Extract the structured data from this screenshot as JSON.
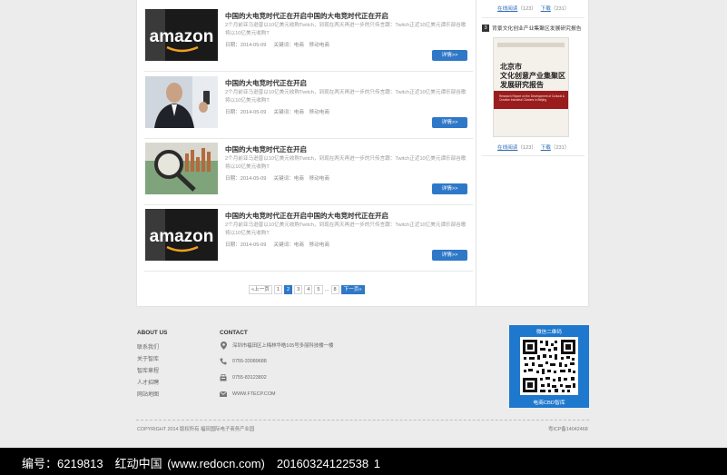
{
  "articles": [
    {
      "title": "中国的大电竞时代正在开启中国的大电竞时代正在开启",
      "desc": "2个月前亚马逊曾以10亿美元收购Twitch，到现在两天再进一步的只传言跟：Twitch正近10亿美元谭乐部谷歌将以10亿美元收购T",
      "date": "日期：2014-05-09",
      "keywords": "关键词：电商　移动电商",
      "more": "详情>>",
      "image": "amazon-logo-photo"
    },
    {
      "title": "中国的大电竞时代正在开启",
      "desc": "2个月前亚马逊曾以10亿美元收购Twitch，到现在两天再进一步的只传言跟：Twitch正近10亿美元谭乐部谷歌将以10亿美元收购T",
      "date": "日期：2014-05-09",
      "keywords": "关键词：电商　移动电商",
      "more": "详情>>",
      "image": "businessman-photo"
    },
    {
      "title": "中国的大电竞时代正在开启",
      "desc": "2个月前亚马逊曾以10亿美元收购Twitch，到现在两天再进一步的只传言跟：Twitch正近10亿美元谭乐部谷歌将以10亿美元收购T",
      "date": "日期：2014-05-09",
      "keywords": "关键词：电商　移动电商",
      "more": "详情>>",
      "image": "magnifier-chart-photo"
    },
    {
      "title": "中国的大电竞时代正在开启中国的大电竞时代正在开启",
      "desc": "2个月前亚马逊曾以10亿美元收购Twitch，到现在两天再进一步的只传言跟：Twitch正近10亿美元谭乐部谷歌将以10亿美元收购T",
      "date": "日期：2014-05-09",
      "keywords": "关键词：电商　移动电商",
      "more": "详情>>",
      "image": "amazon-logo-photo"
    }
  ],
  "pagination": {
    "prev": "«上一页",
    "pages": [
      "1",
      "2",
      "3",
      "4",
      "5"
    ],
    "current": "2",
    "ellipsis": "...",
    "last": "8",
    "next": "下一页»"
  },
  "sidebar": {
    "top_links": {
      "read": "在线阅读",
      "read_count": "（123）",
      "download": "下载",
      "download_count": "（231）"
    },
    "item": {
      "number": "3",
      "title": "背景文化创业产业集聚区发展研究报告",
      "book_head_line1": "北京市",
      "book_head_line2": "文化创意产业集聚区",
      "book_head_line3": "发展研究报告",
      "book_sub": "Research Report on the Development of Cultural & Creative Industrial Clusters in Beijing",
      "read": "在线阅读",
      "read_count": "（123）",
      "download": "下载",
      "download_count": "（231）"
    }
  },
  "footer": {
    "about_heading": "ABOUT US",
    "about_links": [
      "联系我们",
      "关于智库",
      "智库章程",
      "人才招聘",
      "网站地图"
    ],
    "contact_heading": "CONTACT",
    "contact": [
      {
        "icon": "location-icon",
        "text": "深圳市福田区上梅林华皓105号多丽科技楼一楼"
      },
      {
        "icon": "phone-icon",
        "text": "0755-33089688"
      },
      {
        "icon": "fax-icon",
        "text": "0755-83123802"
      },
      {
        "icon": "mail-icon",
        "text": "WWW.FTECP.COM"
      }
    ],
    "qr_title": "微信二维码",
    "qr_label": "电商CBD智库",
    "copyright": "COPYRIGHT 2014 版权所有  福田国际电子商务产业园",
    "icp": "粤ICP备14042468"
  },
  "watermark": "编号：6219813　红动中国 (www.redocn.com)　20160324122538 1",
  "colors": {
    "accent": "#2f78c8",
    "qr_bg": "#1e78cd"
  }
}
